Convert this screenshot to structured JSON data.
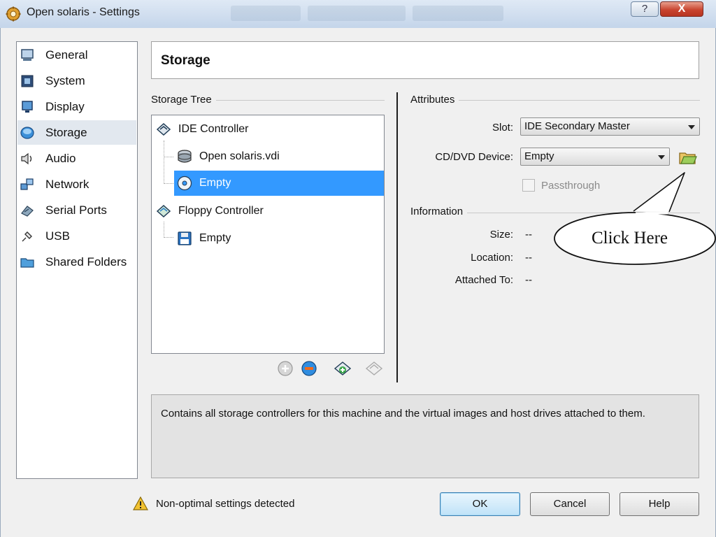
{
  "window": {
    "title": "Open solaris - Settings",
    "help_glyph": "?",
    "close_glyph": "X"
  },
  "sidebar": {
    "items": [
      {
        "label": "General",
        "icon": "monitor-icon"
      },
      {
        "label": "System",
        "icon": "chip-icon"
      },
      {
        "label": "Display",
        "icon": "display-icon"
      },
      {
        "label": "Storage",
        "icon": "storage-disk-icon",
        "selected": true
      },
      {
        "label": "Audio",
        "icon": "speaker-icon"
      },
      {
        "label": "Network",
        "icon": "network-icon"
      },
      {
        "label": "Serial Ports",
        "icon": "serial-port-icon"
      },
      {
        "label": "USB",
        "icon": "usb-plug-icon"
      },
      {
        "label": "Shared Folders",
        "icon": "folder-icon"
      }
    ]
  },
  "page": {
    "title": "Storage"
  },
  "storage_tree": {
    "group_title": "Storage Tree",
    "nodes": [
      {
        "label": "IDE Controller",
        "icon": "ide-controller-icon",
        "level": 0
      },
      {
        "label": "Open solaris.vdi",
        "icon": "hard-disk-icon",
        "level": 1
      },
      {
        "label": "Empty",
        "icon": "cd-icon",
        "level": 1,
        "selected": true
      },
      {
        "label": "Floppy Controller",
        "icon": "floppy-controller-icon",
        "level": 0
      },
      {
        "label": "Empty",
        "icon": "floppy-disk-icon",
        "level": 1
      }
    ],
    "buttons": [
      "add-attachment-icon",
      "remove-attachment-icon",
      "add-controller-icon",
      "remove-controller-icon"
    ]
  },
  "attributes": {
    "group_title": "Attributes",
    "slot_label": "Slot:",
    "slot_value": "IDE Secondary Master",
    "device_label": "CD/DVD Device:",
    "device_value": "Empty",
    "passthrough_label": "Passthrough",
    "passthrough_checked": false
  },
  "information": {
    "group_title": "Information",
    "size_label": "Size:",
    "size_value": "--",
    "location_label": "Location:",
    "location_value": "--",
    "attached_label": "Attached To:",
    "attached_value": "--"
  },
  "callout": {
    "text": "Click Here"
  },
  "description": {
    "text": "Contains all storage controllers for this machine and the virtual images and host drives attached to them."
  },
  "footer": {
    "warning_text": "Non-optimal settings detected",
    "ok_label": "OK",
    "cancel_label": "Cancel",
    "help_label": "Help"
  },
  "colors": {
    "selection": "#3399ff",
    "sidebar_selected": "#e2e8ef",
    "dialog_bg": "#f0f0f0",
    "close_button": "#c94530"
  }
}
